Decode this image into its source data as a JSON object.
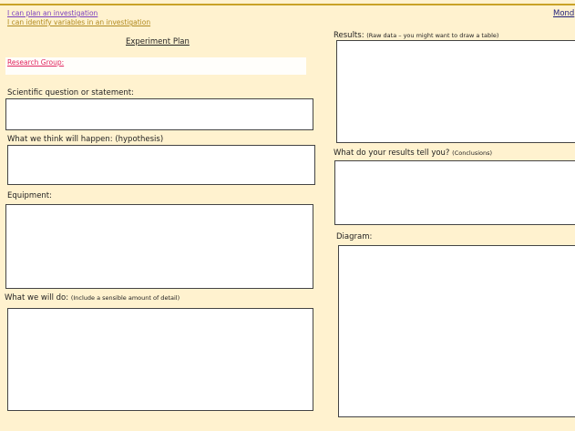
{
  "learning_objectives": [
    "I can plan  an investigation",
    "I can identify variables in an investigation"
  ],
  "date_partial": "Mond",
  "plan_title": "Experiment Plan",
  "research_group_label": "Research Group:",
  "sections": {
    "question": "Scientific question or statement:",
    "hypothesis": "What we think will happen: (hypothesis)",
    "equipment": "Equipment:",
    "method": "What we will do:",
    "method_note": "(Include a sensible amount of detail)",
    "results": "Results:",
    "results_note": "(Raw data – you might want to draw a table)",
    "conclusions": "What do your results tell you?",
    "conclusions_note": "(Conclusions)",
    "diagram": "Diagram:"
  }
}
